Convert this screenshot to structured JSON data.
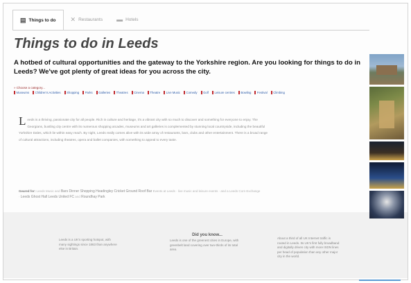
{
  "tabs": [
    {
      "label": "Things to do",
      "icon": "building-icon",
      "active": true
    },
    {
      "label": "Restaurants",
      "icon": "cutlery-icon",
      "active": false
    },
    {
      "label": "Hotels",
      "icon": "bed-icon",
      "active": false
    }
  ],
  "page": {
    "title": "Things to do in Leeds",
    "intro": "A hotbed of cultural opportunities and the gateway to the Yorkshire region. Are you looking for things to do in Leeds? We've got plenty of great ideas for you across the city.",
    "category_heading": "» Choose a category..."
  },
  "categories": [
    "Museums",
    "Children's Activities",
    "Shopping",
    "Parks",
    "Galleries",
    "Theatres",
    "Cinema",
    "Theatre",
    "Live Music",
    "Comedy",
    "Golf",
    "Leisure centres",
    "Bowling",
    "Festival",
    "Climbing"
  ],
  "body": {
    "dropcap": "L",
    "text": "eeds is a thriving, passionate city for all people. Rich in culture and heritage, it's a vibrant city with so much to discover and something for everyone to enjoy. The Georgians, bustling city centre with its numerous shopping arcades, museums and art galleries is complemented by stunning local countryside, including the beautiful Yorkshire Dales, which lie within easy reach. By night, Leeds really comes alive with its wide array of restaurants, bars, clubs and other entertainment. There is a broad range of cultural attractions, including theatres, opera and ballet companies, with something to appeal to every taste."
  },
  "tagline": {
    "label": "Geared for:",
    "text1": "Leeds Music and",
    "highlights": "Bars Dinner Shopping Headingley Cricket Ground Roof Bar",
    "text2": "Events at Leeds · live music and leisure events · and a Leeds Corn Exchange ·",
    "highlights2": "Leeds Ghost Hall Leeds United FC",
    "text3": "and",
    "highlights3": "Roundhay Park"
  },
  "footer": {
    "heading": "Did you know...",
    "facts": [
      "Leeds is a UK's sporting hotspot, with many sightings since 1863 than anywhere else in Britain.",
      "Leeds is one of the greenest cities in Europe, with greenbelt land covering over two-thirds of its total area.",
      "About a third of all UK Internet traffic is routed in Leeds. Its UK's first fully broadband and digitally driven city with more ISDN lines per head of population than any other major city in the world."
    ]
  },
  "thumbnails": [
    {
      "alt": "Castle building"
    },
    {
      "alt": "Historic arcade"
    },
    {
      "alt": "Night skyline"
    },
    {
      "alt": "City at dusk"
    },
    {
      "alt": "Hot air balloon"
    }
  ],
  "colors": {
    "title": "#444444",
    "category_link": "#2b5aa8",
    "category_mark": "#c0282d",
    "footer_bg": "#f1f1f1"
  }
}
